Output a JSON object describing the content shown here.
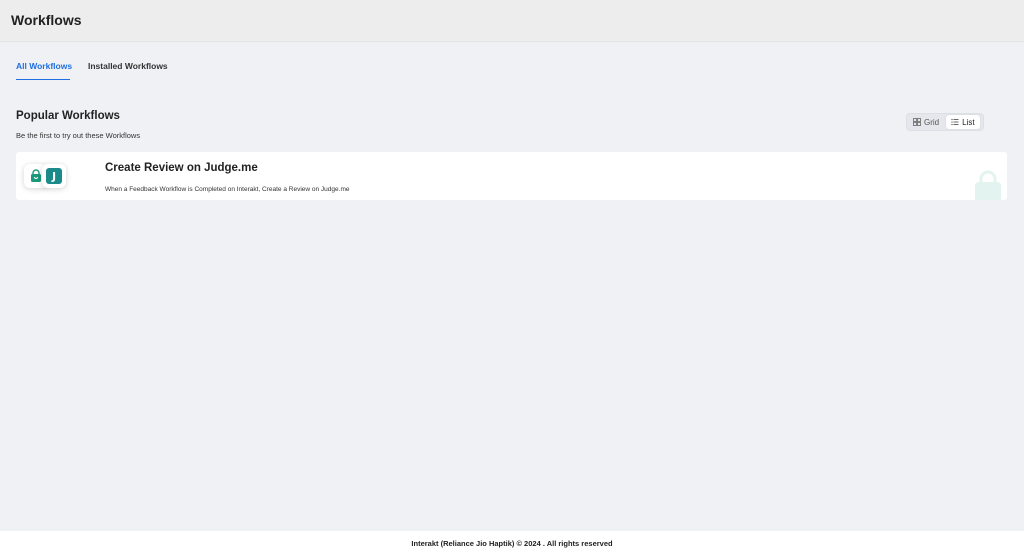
{
  "header": {
    "title": "Workflows"
  },
  "tabs": [
    {
      "label": "All Workflows",
      "active": true
    },
    {
      "label": "Installed Workflows",
      "active": false
    }
  ],
  "section": {
    "title": "Popular Workflows",
    "subtitle": "Be the first to try out these Workflows"
  },
  "view_toggle": {
    "grid_label": "Grid",
    "list_label": "List",
    "selected": "List"
  },
  "workflows": [
    {
      "title": "Create Review on Judge.me",
      "description": "When a Feedback Workflow is Completed on Interakt, Create a Review on Judge.me",
      "icons": [
        "shopify-bag-icon",
        "judgeme-j-icon"
      ],
      "judge_letter": "J"
    }
  ],
  "footer": {
    "text": "Interakt (Reliance Jio Haptik) © 2024 . All rights reserved"
  },
  "colors": {
    "accent": "#1f6fe0",
    "shopify_green": "#1a9a7a",
    "judgeme_teal": "#1a8a8a",
    "background": "#f0f1f5"
  }
}
